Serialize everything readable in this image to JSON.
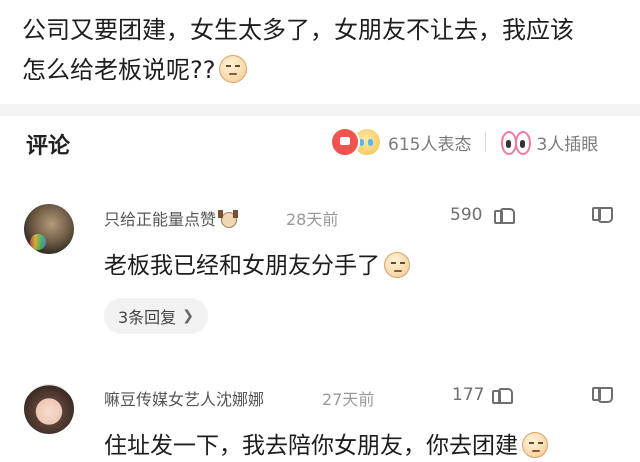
{
  "post": {
    "text_line1": "公司又要团建，女生太多了，女朋友不让去，我应该",
    "text_line2": "怎么给老板说呢??"
  },
  "comments_header": {
    "title": "评论",
    "reactions_count": "615人表态",
    "illustrations_count": "3人插眼"
  },
  "comments": [
    {
      "username": "只给正能量点赞",
      "time": "28天前",
      "likes": "590",
      "content": "老板我已经和女朋友分手了",
      "replies": "3条回复"
    },
    {
      "username": "嘛豆传媒女艺人沈娜娜",
      "time": "27天前",
      "likes": "177",
      "content": "住址发一下，我去陪你女朋友，你去团建"
    }
  ],
  "icons": {
    "post_emoji": "smirk-face-icon",
    "like": "thumb-up-icon",
    "dislike": "thumb-down-icon"
  }
}
